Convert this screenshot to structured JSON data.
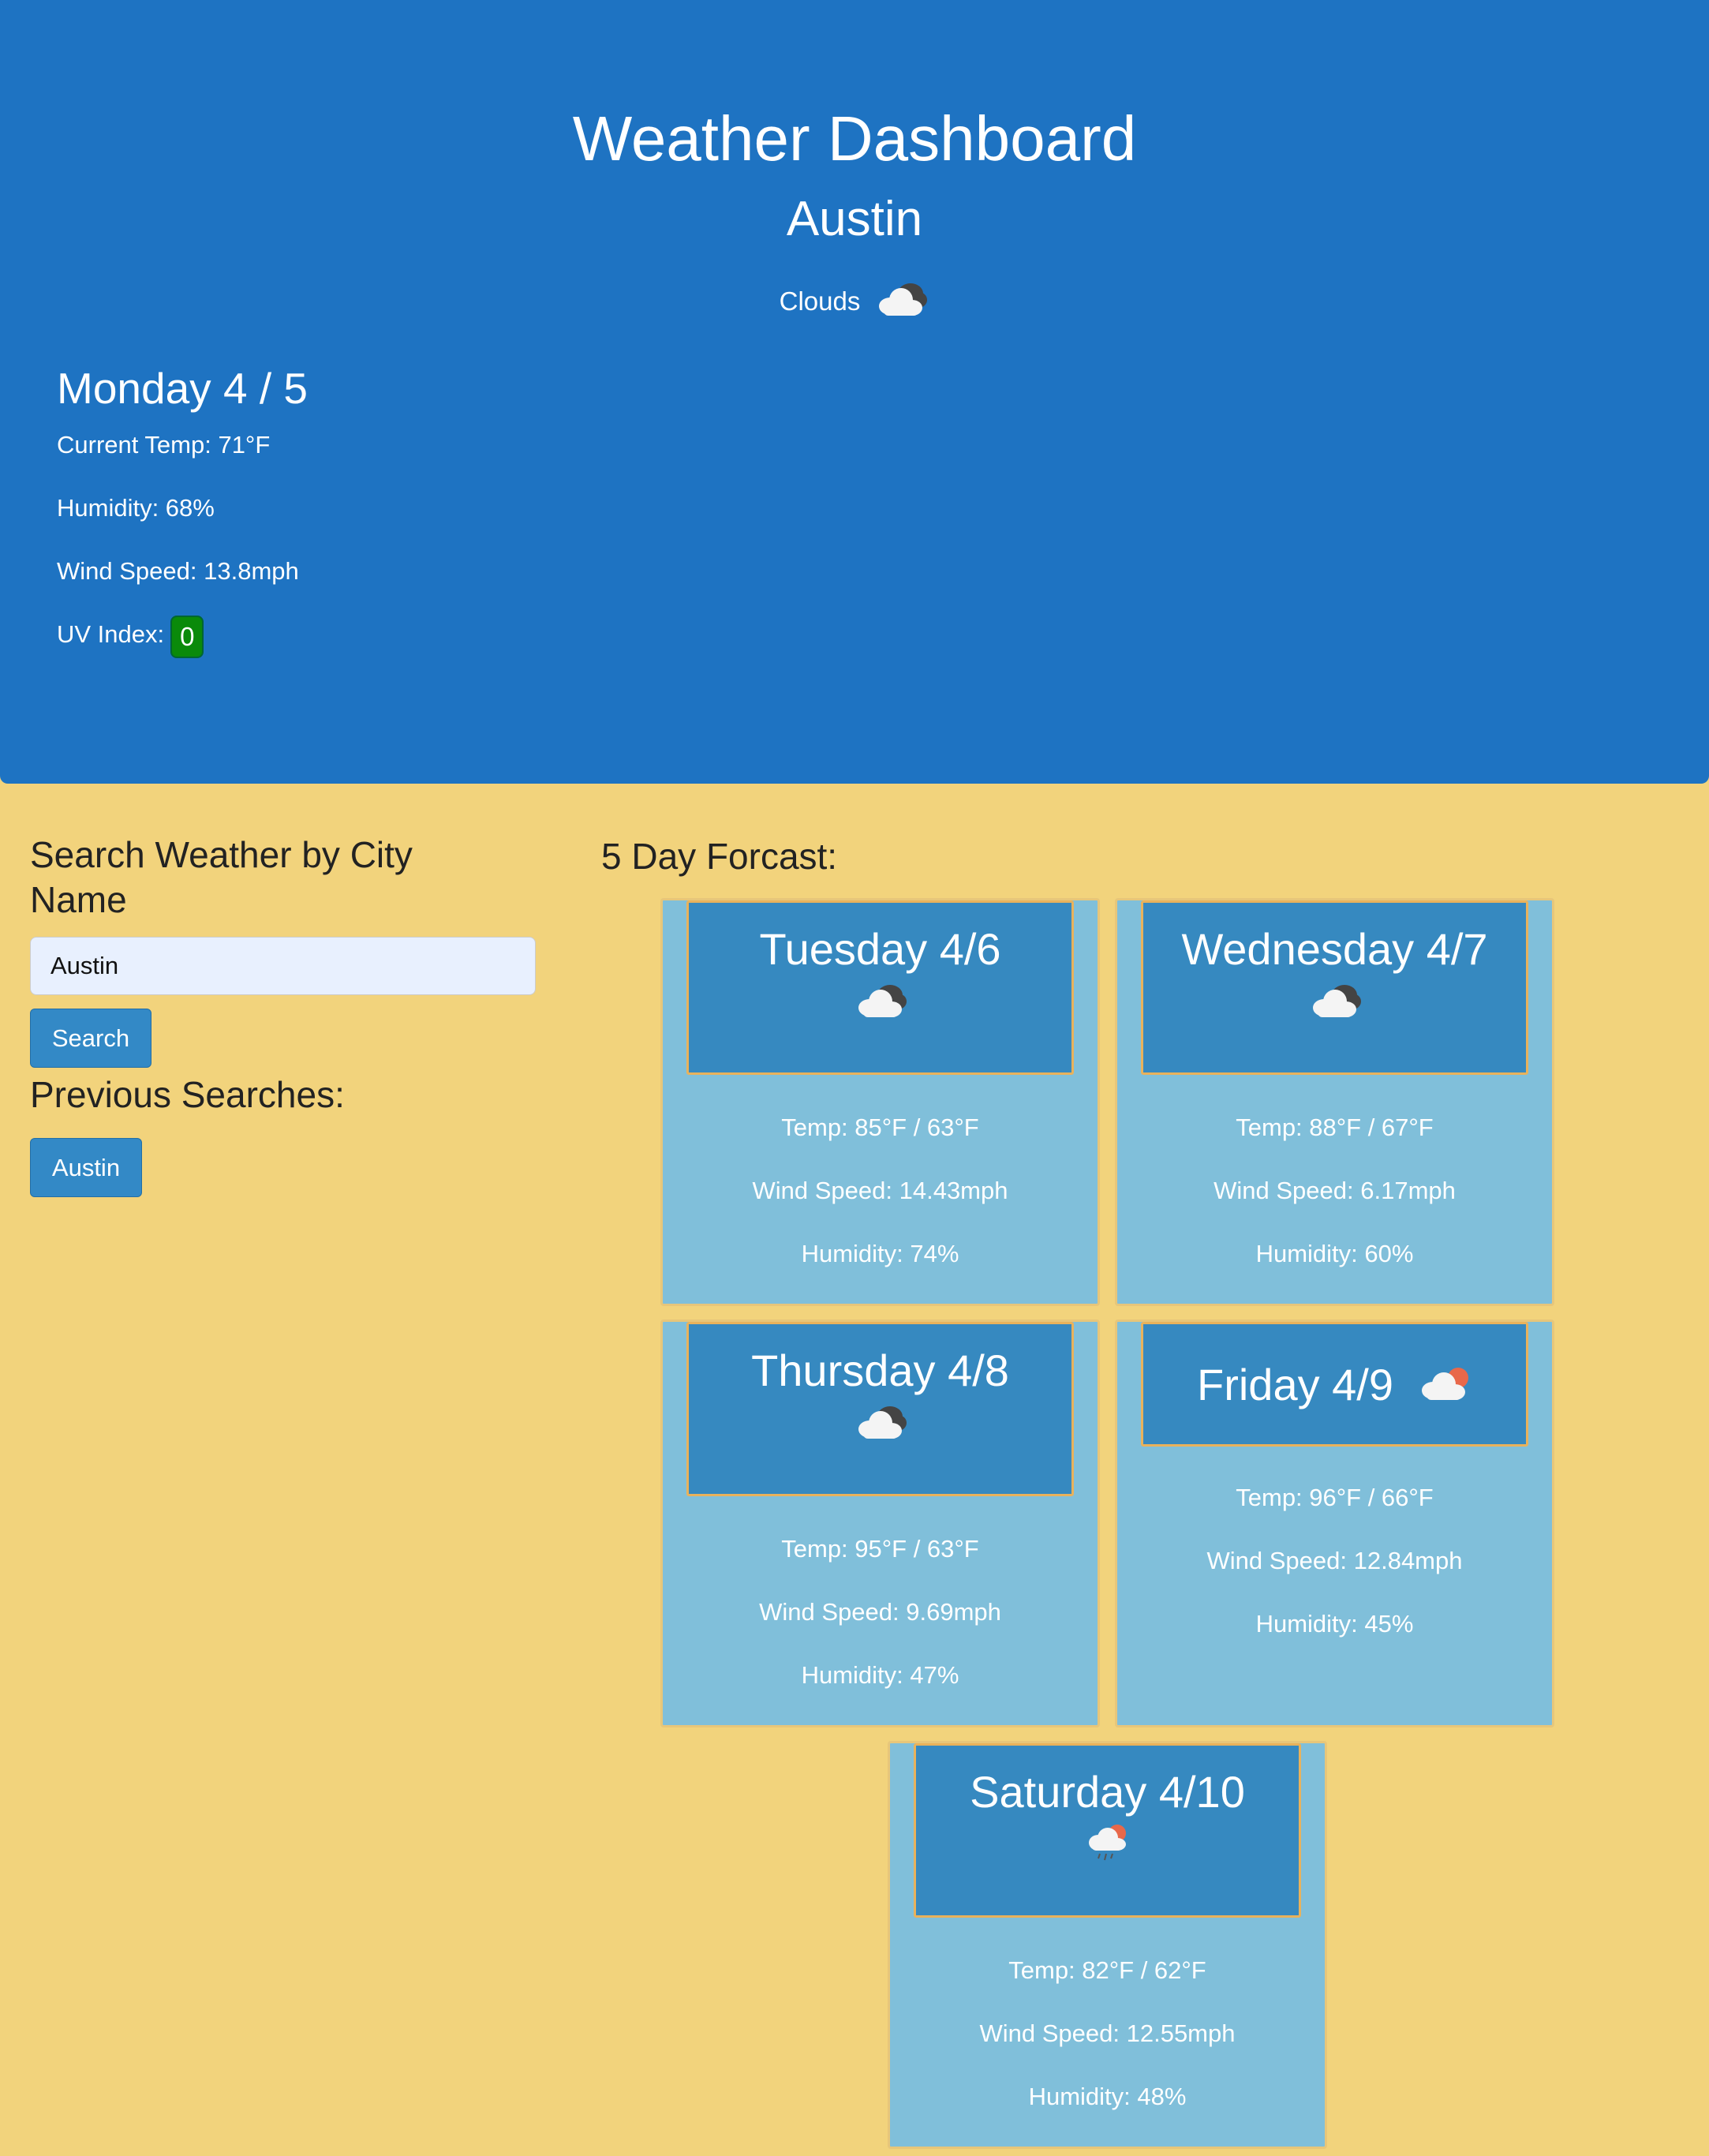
{
  "header": {
    "title": "Weather Dashboard",
    "city": "Austin",
    "condition": "Clouds",
    "condition_icon": "cloud-icon"
  },
  "current": {
    "date": "Monday 4 / 5",
    "temp": "Current Temp: 71°F",
    "humidity": "Humidity: 68%",
    "wind": "Wind Speed: 13.8mph",
    "uv_label": "UV Index:",
    "uv_value": "0",
    "uv_color": "#0a8a0a"
  },
  "search": {
    "title": "Search Weather by City Name",
    "input_value": "Austin",
    "button_label": "Search"
  },
  "previous": {
    "title": "Previous Searches:",
    "items": [
      "Austin"
    ]
  },
  "forecast": {
    "title": "5 Day Forcast:",
    "days": [
      {
        "day": "Tuesday 4/6",
        "icon": "cloud-icon",
        "temp": "Temp: 85°F / 63°F",
        "wind": "Wind Speed: 14.43mph",
        "humidity": "Humidity: 74%"
      },
      {
        "day": "Wednesday 4/7",
        "icon": "cloud-icon",
        "temp": "Temp: 88°F / 67°F",
        "wind": "Wind Speed: 6.17mph",
        "humidity": "Humidity: 60%"
      },
      {
        "day": "Thursday 4/8",
        "icon": "cloud-icon",
        "temp": "Temp: 95°F / 63°F",
        "wind": "Wind Speed: 9.69mph",
        "humidity": "Humidity: 47%"
      },
      {
        "day": "Friday 4/9",
        "icon": "sun-cloud-icon",
        "temp": "Temp: 96°F / 66°F",
        "wind": "Wind Speed: 12.84mph",
        "humidity": "Humidity: 45%"
      },
      {
        "day": "Saturday 4/10",
        "icon": "rain-cloud-icon",
        "temp": "Temp: 82°F / 62°F",
        "wind": "Wind Speed: 12.55mph",
        "humidity": "Humidity: 48%"
      }
    ]
  },
  "colors": {
    "header_bg": "#1e73c2",
    "page_bg": "#f2d37c",
    "card_bg": "#80bfda",
    "card_head_bg": "#3689c0",
    "button_bg": "#3389c6"
  }
}
